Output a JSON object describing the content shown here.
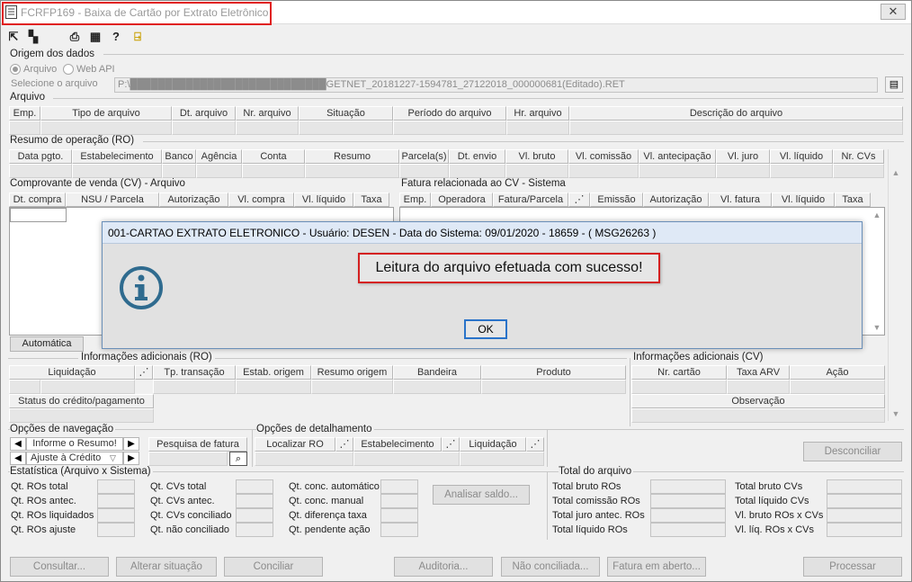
{
  "window": {
    "title": "FCRFP169 - Baixa de Cartão por Extrato Eletrônico",
    "close_glyph": "✕"
  },
  "origem": {
    "section_title": "Origem dos dados",
    "radio_arquivo": "Arquivo",
    "radio_webapi": "Web API",
    "select_label": "Selecione o arquivo",
    "file_path": "P:\\████████████████████████████GETNET_20181227-1594781_27122018_000000681(Editado).RET"
  },
  "arquivo": {
    "section_title": "Arquivo",
    "columns": [
      "Emp.",
      "Tipo de arquivo",
      "Dt. arquivo",
      "Nr. arquivo",
      "Situação",
      "Período do arquivo",
      "Hr. arquivo",
      "Descrição do arquivo"
    ]
  },
  "resumo": {
    "section_title": "Resumo de operação (RO)",
    "columns": [
      "Data pgto.",
      "Estabelecimento",
      "Banco",
      "Agência",
      "Conta",
      "Resumo",
      "Parcela(s)",
      "Dt. envio",
      "Vl. bruto",
      "Vl. comissão",
      "Vl. antecipação",
      "Vl. juro",
      "Vl. líquido",
      "Nr. CVs"
    ]
  },
  "cv": {
    "section_title": "Comprovante de venda (CV) - Arquivo",
    "columns": [
      "Dt. compra",
      "NSU / Parcela",
      "Autorização",
      "Vl. compra",
      "Vl. líquido",
      "Taxa"
    ],
    "automatica_button": "Automática"
  },
  "fatura": {
    "section_title": "Fatura relacionada ao CV - Sistema",
    "columns": [
      "Emp.",
      "Operadora",
      "Fatura/Parcela",
      "",
      "Emissão",
      "Autorização",
      "Vl. fatura",
      "Vl. líquido",
      "Taxa"
    ]
  },
  "info_ro": {
    "section_title": "Informações adicionais (RO)",
    "columns": [
      "Liquidação",
      "",
      "Tp. transação",
      "Estab. origem",
      "Resumo origem",
      "Bandeira",
      "Produto"
    ],
    "status_label": "Status do crédito/pagamento"
  },
  "info_cv": {
    "section_title": "Informações adicionais (CV)",
    "columns": [
      "Nr. cartão",
      "Taxa ARV",
      "Ação"
    ],
    "observacao": "Observação"
  },
  "navegacao": {
    "section_title": "Opções de navegação",
    "combo1": "Informe o Resumo!",
    "combo2": "Ajuste à Crédito",
    "pesquisa_button": "Pesquisa de fatura"
  },
  "detalhamento": {
    "section_title": "Opções de detalhamento",
    "columns": [
      "Localizar RO",
      "",
      "Estabelecimento",
      "",
      "Liquidação",
      ""
    ]
  },
  "desconciliar_button": "Desconciliar",
  "estatistica": {
    "section_title": "Estatística (Arquivo x Sistema)",
    "col1": [
      "Qt. ROs total",
      "Qt. ROs antec.",
      "Qt. ROs liquidados",
      "Qt. ROs ajuste"
    ],
    "col2": [
      "Qt. CVs total",
      "Qt. CVs antec.",
      "Qt. CVs conciliado",
      "Qt. não conciliado"
    ],
    "col3": [
      "Qt. conc. automático",
      "Qt. conc. manual",
      "Qt. diferença taxa",
      "Qt. pendente ação"
    ],
    "analisar_button": "Analisar saldo..."
  },
  "total": {
    "section_title": "Total do arquivo",
    "col1": [
      "Total bruto ROs",
      "Total comissão ROs",
      "Total juro antec. ROs",
      "Total líquido ROs"
    ],
    "col2": [
      "Total bruto CVs",
      "Total líquido CVs",
      "Vl. bruto ROs x CVs",
      "Vl. líq. ROs x CVs"
    ]
  },
  "bottom_buttons": [
    "Consultar...",
    "Alterar situação",
    "Conciliar",
    "Auditoria...",
    "Não conciliada...",
    "Fatura em aberto...",
    "Processar"
  ],
  "dialog": {
    "title": "001-CARTAO EXTRATO ELETRONICO - Usuário: DESEN - Data do Sistema: 09/01/2020 - 18659 - ( MSG26263 )",
    "message": "Leitura do arquivo efetuada com sucesso!",
    "ok_label": "OK"
  },
  "colors": {
    "accent_red": "#e02020",
    "info_icon": "#2f6b8f",
    "dialog_title_bg": "#dfe9f6"
  }
}
